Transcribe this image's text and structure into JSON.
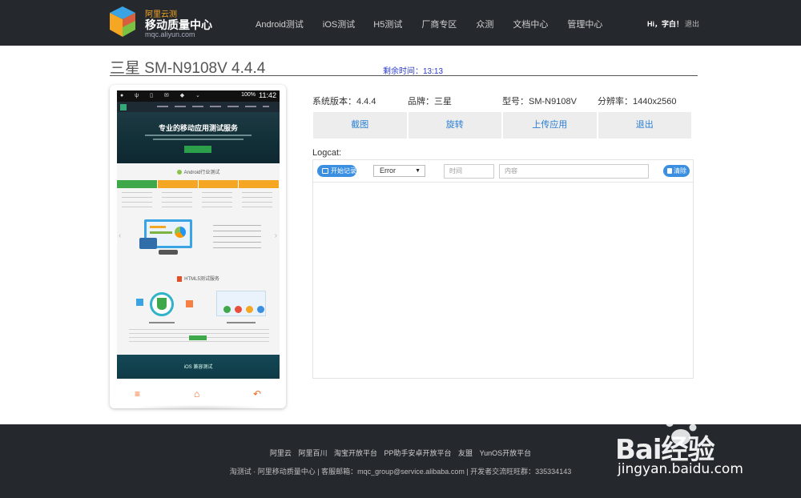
{
  "header": {
    "brand_top": "阿里云测",
    "brand_main": "移动质量中心",
    "brand_url": "mqc.aliyun.com",
    "nav": [
      "Android测试",
      "iOS测试",
      "H5测试",
      "厂商专区",
      "众测",
      "文档中心",
      "管理中心"
    ],
    "greeting": "Hi，字白！",
    "logout": "退出"
  },
  "device": {
    "title": "三星 SM-N9108V 4.4.4",
    "remaining_time": "剩余时间：13:13",
    "info": {
      "system_version": "系统版本：4.4.4",
      "brand": "品牌：三星",
      "model": "型号：SM-N9108V",
      "resolution": "分辨率：1440x2560"
    }
  },
  "phone_screen": {
    "status_time": "11:42",
    "battery": "100%",
    "banner_title": "专业的移动应用测试服务",
    "android_section": "Android行业测试",
    "html5_section": "HTML5测试服务",
    "ios_section": "iOS 兼容测试"
  },
  "actions": [
    "截图",
    "旋转",
    "上传应用",
    "退出"
  ],
  "logcat": {
    "label": "Logcat:",
    "start_button": "开始记录",
    "level_selected": "Error",
    "time_placeholder": "时间",
    "content_placeholder": "内容",
    "clear_button": "清除"
  },
  "footer": {
    "links": [
      "阿里云",
      "阿里百川",
      "淘宝开放平台",
      "PP助手安卓开放平台",
      "友盟",
      "YunOS开放平台"
    ],
    "copyright": "淘测试 · 阿里移动质量中心 | 客服邮箱：mqc_group@service.alibaba.com | 开发者交流旺旺群：335334143"
  },
  "watermark": {
    "brand": "Bai经验",
    "url": "jingyan.baidu.com"
  },
  "colors": {
    "header_bg": "#25292e",
    "accent_blue": "#2a7fd4",
    "button_blue": "#3a8fe0",
    "phone_icon_orange": "#ee6a1f"
  }
}
